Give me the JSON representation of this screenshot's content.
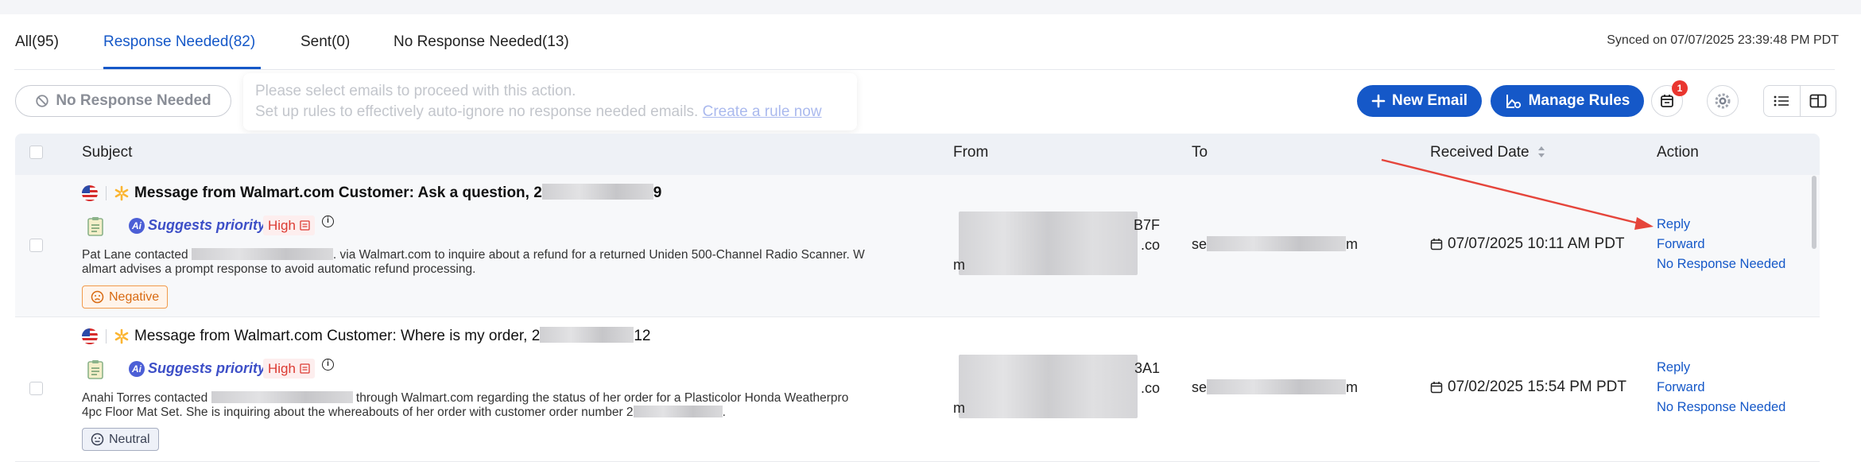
{
  "tabs": [
    {
      "label": "All(95)"
    },
    {
      "label": "Response Needed(82)"
    },
    {
      "label": "Sent(0)"
    },
    {
      "label": "No Response Needed(13)"
    }
  ],
  "synced_text": "Synced on 07/07/2025 23:39:48 PM PDT",
  "toolbar": {
    "no_response_label": "No Response Needed",
    "tooltip_line1": "Please select emails to proceed with this action.",
    "tooltip_line2": "Set up rules to effectively auto-ignore no response needed emails.",
    "tooltip_link": "Create a rule now",
    "new_email_label": "New Email",
    "manage_rules_label": "Manage Rules",
    "calendar_badge": "1"
  },
  "table": {
    "headers": {
      "subject": "Subject",
      "from": "From",
      "to": "To",
      "received": "Received Date",
      "action": "Action"
    },
    "rows": [
      {
        "subject_prefix": "Message from Walmart.com Customer: Ask a question, 2",
        "subject_suffix": "9",
        "suggests": "Suggests priority:",
        "priority": "High",
        "summary_a": "Pat Lane contacted",
        "summary_b": ". via Walmart.com to inquire about a refund for a returned Uniden 500-Channel Radio Scanner. W",
        "summary_c": "almart advises a prompt response to avoid automatic refund processing.",
        "sentiment": "Negative",
        "from_l1": "B7F",
        "from_l2": ".co",
        "from_l3": "m",
        "to_prefix": "se",
        "to_suffix": "m",
        "date": "07/07/2025 10:11 AM PDT",
        "actions": [
          "Reply",
          "Forward",
          "No Response Needed"
        ]
      },
      {
        "subject_prefix": "Message from Walmart.com Customer: Where is my order, 2",
        "subject_suffix": "12",
        "suggests": "Suggests priority:",
        "priority": "High",
        "summary_a": "Anahi Torres contacted",
        "summary_b": "through Walmart.com regarding the status of her order for a Plasticolor Honda Weatherpro",
        "summary_c": "4pc Floor Mat Set. She is inquiring about the whereabouts of her order with customer order number 2",
        "summary_d": ".",
        "sentiment": "Neutral",
        "from_l1": "3A1",
        "from_l2": ".co",
        "from_l3": "m",
        "to_prefix": "se",
        "to_suffix": "m",
        "date": "07/02/2025 15:54 PM PDT",
        "actions": [
          "Reply",
          "Forward",
          "No Response Needed"
        ]
      }
    ]
  },
  "colors": {
    "accent": "#1558c8",
    "priority_high": "#dc3a32",
    "annotation_arrow": "#e5453b"
  }
}
